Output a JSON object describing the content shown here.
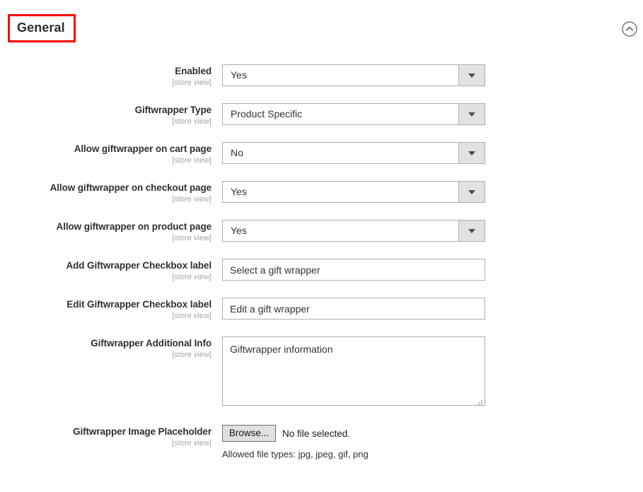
{
  "section": {
    "title": "General",
    "highlight_color": "#ff0000",
    "collapse_icon": "chevron-up-circle-icon"
  },
  "fields": [
    {
      "label": "Enabled",
      "scope": "[store view]",
      "type": "select",
      "value": "Yes"
    },
    {
      "label": "Giftwrapper Type",
      "scope": "[store view]",
      "type": "select",
      "value": "Product Specific"
    },
    {
      "label": "Allow giftwrapper on cart page",
      "scope": "[store view]",
      "type": "select",
      "value": "No"
    },
    {
      "label": "Allow giftwrapper on checkout page",
      "scope": "[store view]",
      "type": "select",
      "value": "Yes"
    },
    {
      "label": "Allow giftwrapper on product page",
      "scope": "[store view]",
      "type": "select",
      "value": "Yes"
    },
    {
      "label": "Add Giftwrapper Checkbox label",
      "scope": "[store view]",
      "type": "text",
      "value": "Select a gift wrapper"
    },
    {
      "label": "Edit Giftwrapper Checkbox label",
      "scope": "[store view]",
      "type": "text",
      "value": "Edit a gift wrapper"
    },
    {
      "label": "Giftwrapper Additional Info",
      "scope": "[store view]",
      "type": "textarea",
      "value": "Giftwrapper information"
    },
    {
      "label": "Giftwrapper Image Placeholder",
      "scope": "[store view]",
      "type": "file",
      "browse_label": "Browse...",
      "file_status": "No file selected.",
      "note": "Allowed file types: jpg, jpeg, gif, png"
    }
  ]
}
